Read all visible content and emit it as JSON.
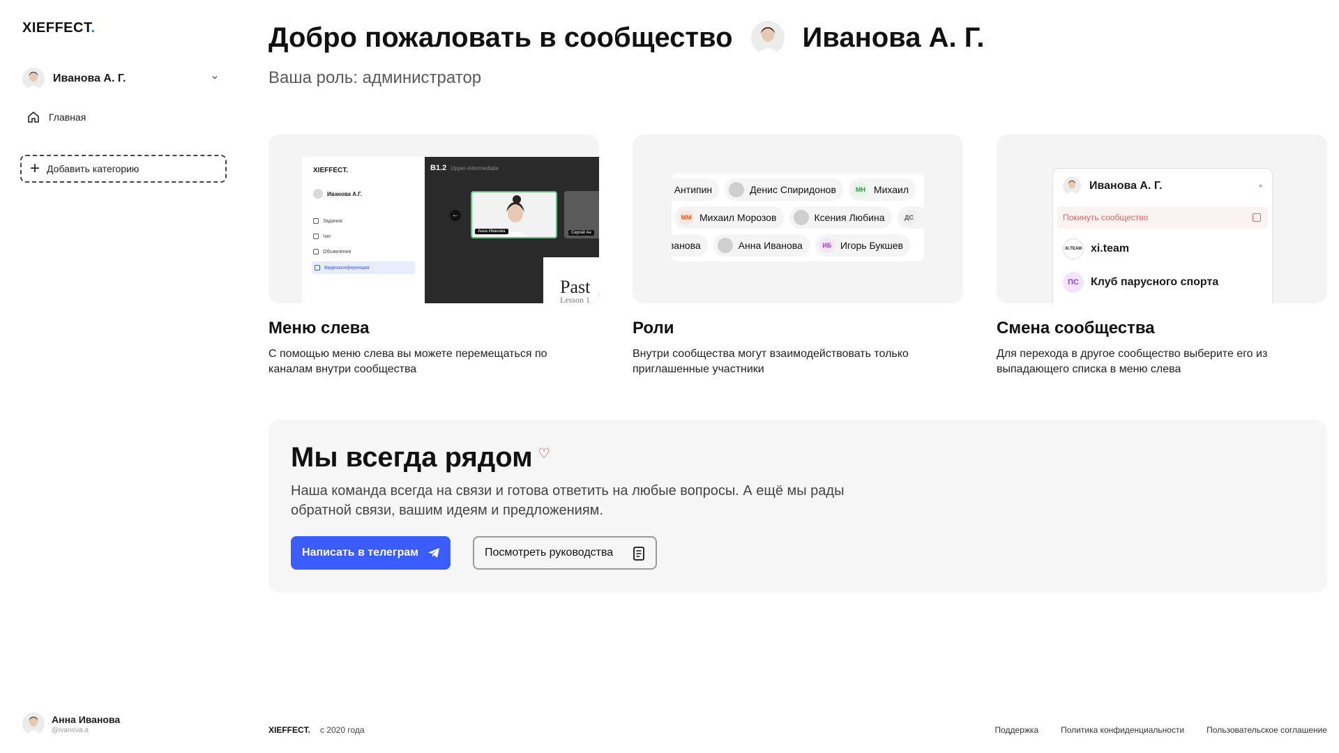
{
  "sidebar": {
    "logo": "XIEFFECT",
    "logo_dot": ".",
    "user_name": "Иванова А. Г.",
    "nav": [
      {
        "label": "Главная",
        "icon": "home-icon"
      }
    ],
    "add_category": "Добавить категорию",
    "bottom_user": {
      "name": "Анна Иванова",
      "handle": "@ivanova.a"
    }
  },
  "header": {
    "welcome": "Добро пожаловать в сообщество",
    "community_name": "Иванова А. Г.",
    "role": "Ваша роль: администратор"
  },
  "cards": [
    {
      "title": "Меню слева",
      "desc": "С помощью меню слева вы можете перемещаться по каналам внутри сообщества",
      "mock": {
        "logo": "XIEFFECT.",
        "user": "Иванова А.Г.",
        "items": [
          "Задания",
          "Чат",
          "Объявления",
          "Видеоконференция"
        ],
        "level": "B1.2",
        "level_name": "Upper-intermediate",
        "video_label": "Анна Иванова",
        "video_label2": "Сергей Ан",
        "paper_title": "Past",
        "paper_sub": "Lesson 1"
      }
    },
    {
      "title": "Роли",
      "desc": "Внутри сообщества могут взаимодействовать только приглашенные участники",
      "mock": {
        "row1": [
          {
            "name": "й Антипин",
            "initials": "",
            "kind": "none"
          },
          {
            "name": "Денис Спиридонов",
            "initials": "",
            "kind": "ph"
          },
          {
            "name": "Михаил",
            "initials": "МН",
            "kind": "mh"
          }
        ],
        "row2": [
          {
            "name": "Михаил Морозов",
            "initials": "ММ",
            "kind": "mm"
          },
          {
            "name": "Ксения Любина",
            "initials": "",
            "kind": "ph"
          },
          {
            "name": "",
            "initials": "ДС",
            "kind": "ds"
          }
        ],
        "row3": [
          {
            "name": "ванова",
            "initials": "",
            "kind": "none"
          },
          {
            "name": "Анна Иванова",
            "initials": "",
            "kind": "ph"
          },
          {
            "name": "Игорь Букшев",
            "initials": "ИБ",
            "kind": "ib"
          }
        ]
      }
    },
    {
      "title": "Смена сообщества",
      "desc": "Для перехода в другое сообщество выберите его из выпадающего списка в меню слева",
      "mock": {
        "user": "Иванова А. Г.",
        "leave": "Покинуть сообщество",
        "items": [
          {
            "name": "xi.team",
            "initials": "XI.TEAM"
          },
          {
            "name": "Клуб парусного спорта",
            "initials": "ПС"
          }
        ]
      }
    }
  ],
  "help": {
    "title": "Мы всегда рядом",
    "text": "Наша команда всегда на связи и готова ответить на любые вопросы. А ещё мы рады обратной связи, вашим идеям и предложениям.",
    "btn_telegram": "Написать в телеграм",
    "btn_guides": "Посмотреть руководства"
  },
  "footer": {
    "logo": "XIEFFECT.",
    "since": "с 2020 года",
    "links": [
      "Поддержка",
      "Политика конфиденциальности",
      "Пользовательское соглашение"
    ]
  },
  "colors": {
    "accent": "#3b5cff",
    "card_bg": "#f4f4f4",
    "leave": "#e06666"
  }
}
